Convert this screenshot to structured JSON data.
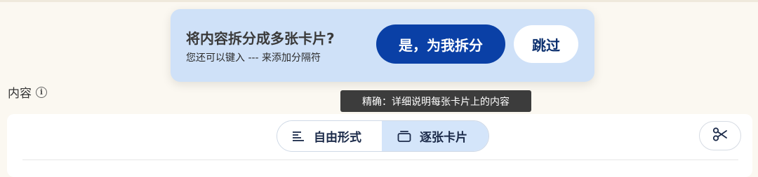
{
  "prompt": {
    "title": "将内容拆分成多张卡片?",
    "subtitle": "您还可以键入 --- 来添加分隔符",
    "confirm_label": "是，为我拆分",
    "skip_label": "跳过"
  },
  "content": {
    "label": "内容",
    "info_glyph": "i"
  },
  "tooltip": {
    "text": "精确：详细说明每张卡片上的内容"
  },
  "editor": {
    "mode_options": [
      {
        "label": "自由形式",
        "icon": "text-align-left-icon",
        "selected": false
      },
      {
        "label": "逐张卡片",
        "icon": "card-stack-icon",
        "selected": true
      }
    ],
    "scissors_icon": "scissors-icon"
  },
  "colors": {
    "primary": "#0a40a6",
    "banner_bg": "#cfe1f8",
    "selected_tab_bg": "#d4e5fa",
    "page_bg": "#fbf8f1",
    "tooltip_bg": "#3c3c3c"
  }
}
